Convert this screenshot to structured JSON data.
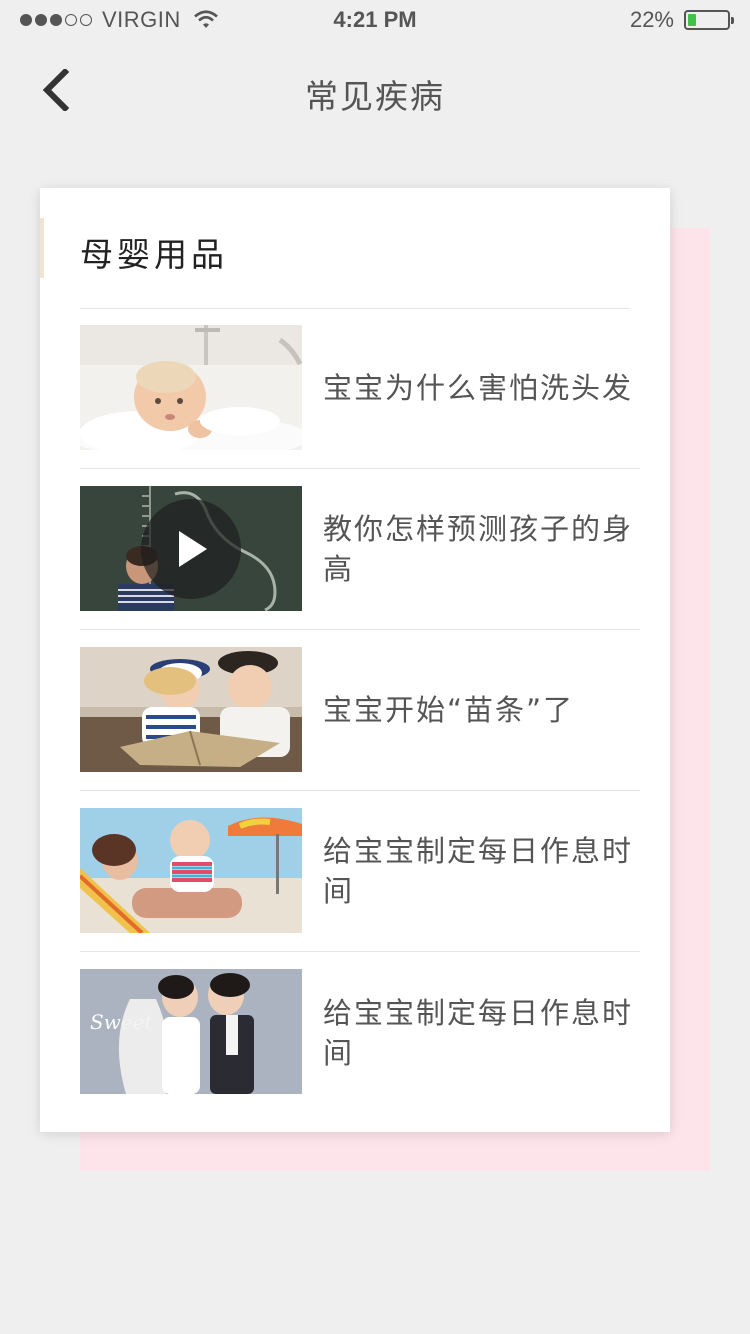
{
  "status": {
    "carrier": "VIRGIN",
    "time": "4:21 PM",
    "battery": "22%",
    "battery_level": 0.22
  },
  "nav": {
    "title": "常见疾病",
    "back_icon": "chevron-left-icon"
  },
  "card": {
    "title": "母婴用品"
  },
  "articles": [
    {
      "title": "宝宝为什么害怕洗头发",
      "thumb": "baby-bath"
    },
    {
      "title": "教你怎样预测孩子的身高",
      "thumb": "height-chalkboard",
      "video": true
    },
    {
      "title": "宝宝开始“苗条”了",
      "thumb": "kids-reading"
    },
    {
      "title": "给宝宝制定每日作息时间",
      "thumb": "mother-baby-beach"
    },
    {
      "title": "给宝宝制定每日作息时间",
      "thumb": "sweet-kids-kiss"
    }
  ],
  "colors": {
    "background": "#efefef",
    "card": "#ffffff",
    "pink_backdrop": "#fde3ea",
    "battery": "#3fc14a",
    "text": "#555555"
  }
}
